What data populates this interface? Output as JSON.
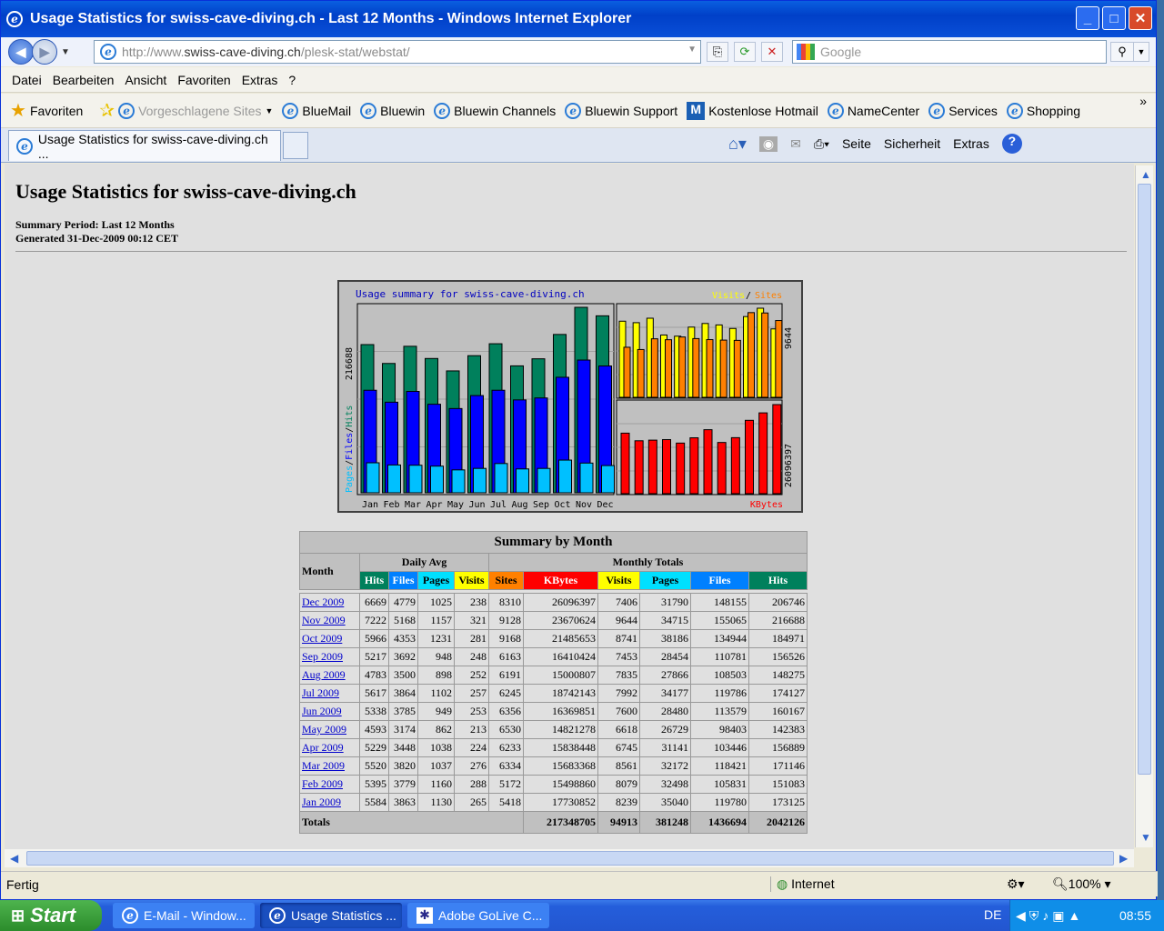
{
  "window": {
    "title": "Usage Statistics for swiss-cave-diving.ch - Last 12 Months - Windows Internet Explorer"
  },
  "address": {
    "url_prefix": "http://www.",
    "url_host": "swiss-cave-diving.ch",
    "url_path": "/plesk-stat/webstat/",
    "search_placeholder": "Google"
  },
  "menu": [
    "Datei",
    "Bearbeiten",
    "Ansicht",
    "Favoriten",
    "Extras",
    "?"
  ],
  "favorites": {
    "label": "Favoriten",
    "items": [
      "Vorgeschlagene Sites",
      "BlueMail",
      "Bluewin",
      "Bluewin Channels",
      "Bluewin Support",
      "Kostenlose Hotmail",
      "NameCenter",
      "Services",
      "Shopping"
    ]
  },
  "tab": {
    "title": "Usage Statistics for swiss-cave-diving.ch ..."
  },
  "commandbar": {
    "page": "Seite",
    "safety": "Sicherheit",
    "tools": "Extras"
  },
  "page": {
    "title": "Usage Statistics for swiss-cave-diving.ch",
    "period": "Summary Period: Last 12 Months",
    "generated": "Generated 31-Dec-2009 00:12 CET"
  },
  "chart_data": {
    "type": "bar",
    "title": "Usage summary for swiss-cave-diving.ch",
    "categories": [
      "Jan",
      "Feb",
      "Mar",
      "Apr",
      "May",
      "Jun",
      "Jul",
      "Aug",
      "Sep",
      "Oct",
      "Nov",
      "Dec"
    ],
    "left_axis_max_label": "216688",
    "left_legend": [
      "Pages",
      "Files",
      "Hits"
    ],
    "top_right_legend": [
      "Visits",
      "Sites"
    ],
    "top_right_max_label": "9644",
    "bottom_right_max_label": "26096397",
    "bottom_right_legend": "KBytes",
    "series": [
      {
        "name": "Hits",
        "values": [
          173125,
          151083,
          171146,
          156889,
          142383,
          160167,
          174127,
          148275,
          156526,
          184971,
          216688,
          206746
        ]
      },
      {
        "name": "Files",
        "values": [
          119780,
          105831,
          118421,
          103446,
          98403,
          113579,
          119786,
          108503,
          110781,
          134944,
          155065,
          148155
        ]
      },
      {
        "name": "Pages",
        "values": [
          35040,
          32498,
          32172,
          31141,
          26729,
          28480,
          34177,
          27866,
          28454,
          38186,
          34715,
          31790
        ]
      },
      {
        "name": "Visits",
        "values": [
          8239,
          8079,
          8561,
          6745,
          6618,
          7600,
          7992,
          7835,
          7453,
          8741,
          9644,
          7406
        ]
      },
      {
        "name": "Sites",
        "values": [
          5418,
          5172,
          6334,
          6233,
          6530,
          6356,
          6245,
          6191,
          6163,
          9168,
          9128,
          8310
        ]
      },
      {
        "name": "KBytes",
        "values": [
          17730852,
          15498860,
          15683368,
          15838448,
          14821278,
          16369851,
          18742143,
          15000807,
          16410424,
          21485653,
          23670624,
          26096397
        ]
      }
    ],
    "colors": {
      "Hits": "#00805c",
      "Files": "#0000ff",
      "Pages": "#00c0ff",
      "Visits": "#ffff00",
      "Sites": "#ff8000",
      "KBytes": "#ff0000"
    }
  },
  "table": {
    "caption": "Summary by Month",
    "month_header": "Month",
    "daily_avg_header": "Daily Avg",
    "monthly_totals_header": "Monthly Totals",
    "columns": [
      "Hits",
      "Files",
      "Pages",
      "Visits",
      "Sites",
      "KBytes",
      "Visits",
      "Pages",
      "Files",
      "Hits"
    ],
    "rows": [
      [
        "Dec 2009",
        "6669",
        "4779",
        "1025",
        "238",
        "8310",
        "26096397",
        "7406",
        "31790",
        "148155",
        "206746"
      ],
      [
        "Nov 2009",
        "7222",
        "5168",
        "1157",
        "321",
        "9128",
        "23670624",
        "9644",
        "34715",
        "155065",
        "216688"
      ],
      [
        "Oct 2009",
        "5966",
        "4353",
        "1231",
        "281",
        "9168",
        "21485653",
        "8741",
        "38186",
        "134944",
        "184971"
      ],
      [
        "Sep 2009",
        "5217",
        "3692",
        "948",
        "248",
        "6163",
        "16410424",
        "7453",
        "28454",
        "110781",
        "156526"
      ],
      [
        "Aug 2009",
        "4783",
        "3500",
        "898",
        "252",
        "6191",
        "15000807",
        "7835",
        "27866",
        "108503",
        "148275"
      ],
      [
        "Jul 2009",
        "5617",
        "3864",
        "1102",
        "257",
        "6245",
        "18742143",
        "7992",
        "34177",
        "119786",
        "174127"
      ],
      [
        "Jun 2009",
        "5338",
        "3785",
        "949",
        "253",
        "6356",
        "16369851",
        "7600",
        "28480",
        "113579",
        "160167"
      ],
      [
        "May 2009",
        "4593",
        "3174",
        "862",
        "213",
        "6530",
        "14821278",
        "6618",
        "26729",
        "98403",
        "142383"
      ],
      [
        "Apr 2009",
        "5229",
        "3448",
        "1038",
        "224",
        "6233",
        "15838448",
        "6745",
        "31141",
        "103446",
        "156889"
      ],
      [
        "Mar 2009",
        "5520",
        "3820",
        "1037",
        "276",
        "6334",
        "15683368",
        "8561",
        "32172",
        "118421",
        "171146"
      ],
      [
        "Feb 2009",
        "5395",
        "3779",
        "1160",
        "288",
        "5172",
        "15498860",
        "8079",
        "32498",
        "105831",
        "151083"
      ],
      [
        "Jan 2009",
        "5584",
        "3863",
        "1130",
        "265",
        "5418",
        "17730852",
        "8239",
        "35040",
        "119780",
        "173125"
      ]
    ],
    "totals_label": "Totals",
    "totals": [
      "217348705",
      "94913",
      "381248",
      "1436694",
      "2042126"
    ]
  },
  "status": {
    "text": "Fertig",
    "zone": "Internet",
    "zoom": "100%"
  },
  "taskbar": {
    "start": "Start",
    "tasks": [
      "E-Mail - Window...",
      "Usage Statistics ...",
      "Adobe GoLive C..."
    ],
    "lang": "DE",
    "clock": "08:55"
  }
}
